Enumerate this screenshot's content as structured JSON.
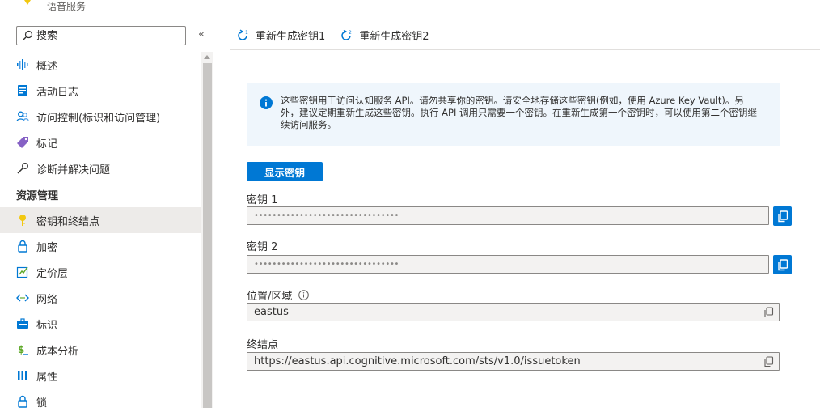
{
  "service": {
    "name": "语音服务"
  },
  "sidebar": {
    "search": {
      "placeholder": "搜索"
    },
    "collapse_label": "«",
    "items_top": [
      {
        "label": "概述",
        "icon": "waveform-icon"
      },
      {
        "label": "活动日志",
        "icon": "log-icon"
      },
      {
        "label": "访问控制(标识和访问管理)",
        "icon": "people-icon"
      },
      {
        "label": "标记",
        "icon": "tag-icon"
      },
      {
        "label": "诊断并解决问题",
        "icon": "wrench-icon"
      }
    ],
    "section_title": "资源管理",
    "items_section": [
      {
        "label": "密钥和终结点",
        "icon": "key-icon",
        "selected": true
      },
      {
        "label": "加密",
        "icon": "lock-icon"
      },
      {
        "label": "定价层",
        "icon": "pricing-icon"
      },
      {
        "label": "网络",
        "icon": "network-icon"
      },
      {
        "label": "标识",
        "icon": "identity-icon"
      },
      {
        "label": "成本分析",
        "icon": "cost-icon"
      },
      {
        "label": "属性",
        "icon": "properties-icon"
      },
      {
        "label": "锁",
        "icon": "lock-icon"
      }
    ]
  },
  "toolbar": {
    "regen_key1": "重新生成密钥1",
    "regen_key2": "重新生成密钥2"
  },
  "info": {
    "text": "这些密钥用于访问认知服务 API。请勿共享你的密钥。请安全地存储这些密钥(例如，使用 Azure Key Vault)。另外，建议定期重新生成这些密钥。执行 API 调用只需要一个密钥。在重新生成第一个密钥时，可以使用第二个密钥继续访问服务。"
  },
  "show_keys_label": "显示密钥",
  "fields": {
    "key1": {
      "label": "密钥 1",
      "value": "••••••••••••••••••••••••••••••••"
    },
    "key2": {
      "label": "密钥 2",
      "value": "••••••••••••••••••••••••••••••••"
    },
    "region": {
      "label": "位置/区域",
      "value": "eastus"
    },
    "endpoint": {
      "label": "终结点",
      "value": "https://eastus.api.cognitive.microsoft.com/sts/v1.0/issuetoken"
    }
  },
  "colors": {
    "accent": "#0078d4",
    "info_bg": "#eff6fc",
    "selected_bg": "#edebe9"
  }
}
